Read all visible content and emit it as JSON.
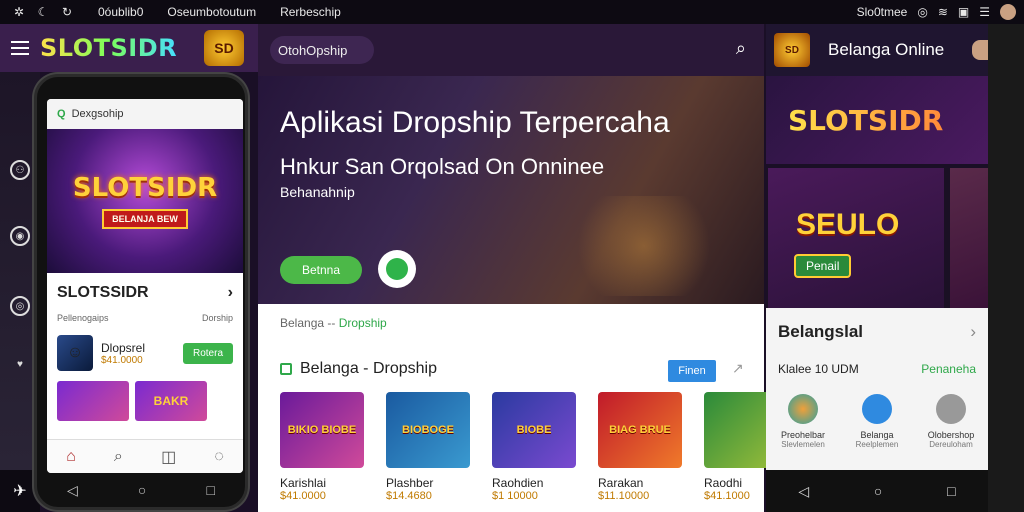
{
  "status_bar": {
    "left_text_1": "БОлуибгбо",
    "left_text_1_display": "0óublib0",
    "tab_1": "0óublib0",
    "tab_2": "Oseumbotoutum",
    "tab_3": "Rerbeschip",
    "right_text": "Slo0tmee"
  },
  "left_app": {
    "brand": "SLOTSIDR",
    "badge": "SD",
    "phone_search_placeholder": "Dexgsohip",
    "hero_title": "SLOTSIDR",
    "hero_sub": "BELANJA BEW",
    "app_title": "SLOTSSIDR",
    "meta_left": "Pellenogaips",
    "meta_right": "Dorship",
    "app_name": "Dlopsrel",
    "app_price": "$41.0000",
    "install_label": "Rotera",
    "thumb_1": "",
    "thumb_2": "BAKR"
  },
  "mid": {
    "search_label": "OtohOpship",
    "hero_title": "Aplikasi Dropship Terpercaha",
    "hero_sub": "Hnkur San Orqolsad On Onninee",
    "hero_sub2": "Behanahnip",
    "hero_button": "Betnna",
    "crumb_prefix": "Belanga -- ",
    "crumb_link": "Dropship",
    "section_title": "Belanga - Dropship",
    "filter_label": "Finen",
    "products": [
      {
        "img": "BIKIO BIOBE",
        "name": "Karishlai",
        "price": "$41.0000"
      },
      {
        "img": "BIOBOGE",
        "name": "Plashber",
        "price": "$14.4680"
      },
      {
        "img": "BIOBE",
        "name": "Raohdien",
        "price": "$1 10000"
      },
      {
        "img": "BIAG BRUE",
        "name": "Rarakan",
        "price": "$11.10000"
      },
      {
        "img": "",
        "name": "Raodhi",
        "price": "$41.1000"
      }
    ]
  },
  "right": {
    "logo": "SD",
    "title": "Belanga Online",
    "banner": "SLOTSIDR",
    "game_title": "SEULO",
    "game_button": "Penail",
    "section_title": "Belangslal",
    "row_left": "Klalee 10 UDM",
    "row_right": "Penaneha",
    "icons": [
      {
        "label": "Preohelbar",
        "sub": "Slevlemelen",
        "color": "#f07a2a"
      },
      {
        "label": "Belanga",
        "sub": "Reelplemen",
        "color": "#2f8ae0"
      },
      {
        "label": "Olobershop",
        "sub": "Dereuloham",
        "color": "#888888"
      }
    ]
  }
}
